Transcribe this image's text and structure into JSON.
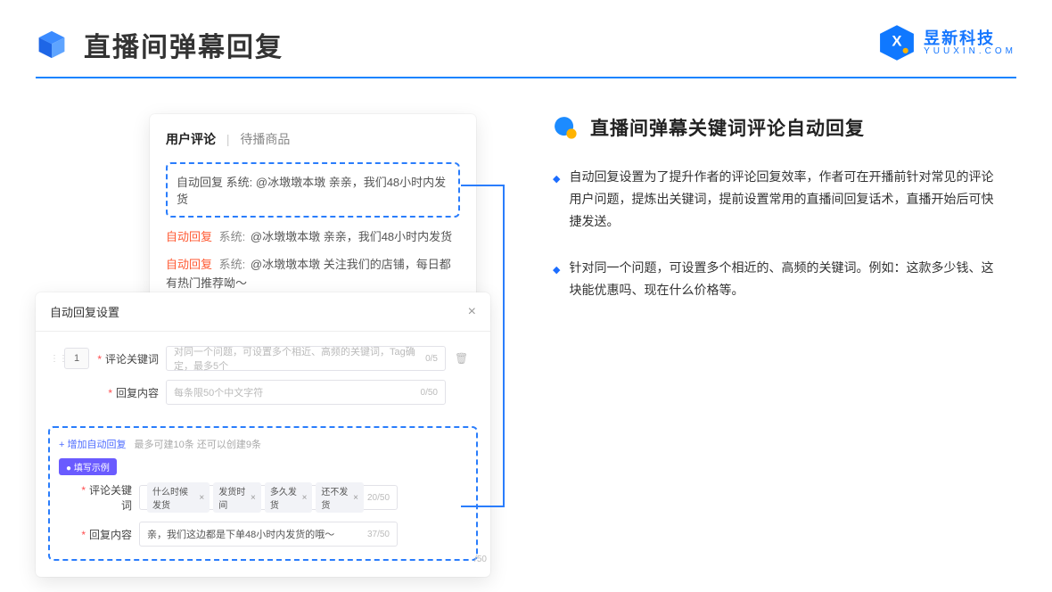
{
  "header": {
    "title": "直播间弹幕回复"
  },
  "brand": {
    "cn": "昱新科技",
    "en": "YUUXIN.COM"
  },
  "topCard": {
    "tab_active": "用户评论",
    "tab_inactive": "待播商品",
    "msgs": [
      {
        "tag": "自动回复",
        "sys": "系统:",
        "text": "@冰墩墩本墩 亲亲，我们48小时内发货"
      },
      {
        "tag": "自动回复",
        "sys": "系统:",
        "text": "@冰墩墩本墩 亲亲，我们48小时内发货"
      },
      {
        "tag": "自动回复",
        "sys": "系统:",
        "text": "@冰墩墩本墩 关注我们的店铺，每日都有热门推荐呦～"
      }
    ]
  },
  "modal": {
    "title": "自动回复设置",
    "num": "1",
    "kw_label": "评论关键词",
    "kw_ph": "对同一个问题，可设置多个相近、高频的关键词，Tag确定，最多5个",
    "kw_count": "0/5",
    "ct_label": "回复内容",
    "ct_ph": "每条限50个中文字符",
    "ct_count": "0/50",
    "addlink": "+ 增加自动回复",
    "addhint": "最多可建10条 还可以创建9条",
    "badge": "● 填写示例",
    "ex_kw_label": "评论关键词",
    "ex_tags": [
      "什么时候发货",
      "发货时间",
      "多久发货",
      "还不发货"
    ],
    "ex_kw_count": "20/50",
    "ex_ct_label": "回复内容",
    "ex_ct_text": "亲，我们这边都是下单48小时内发货的哦～",
    "ex_ct_count": "37/50",
    "outer_count": "/50"
  },
  "right": {
    "heading": "直播间弹幕关键词评论自动回复",
    "b1": "自动回复设置为了提升作者的评论回复效率，作者可在开播前针对常见的评论用户问题，提炼出关键词，提前设置常用的直播间回复话术，直播开始后可快捷发送。",
    "b2": "针对同一个问题，可设置多个相近的、高频的关键词。例如：这款多少钱、这块能优惠吗、现在什么价格等。"
  }
}
